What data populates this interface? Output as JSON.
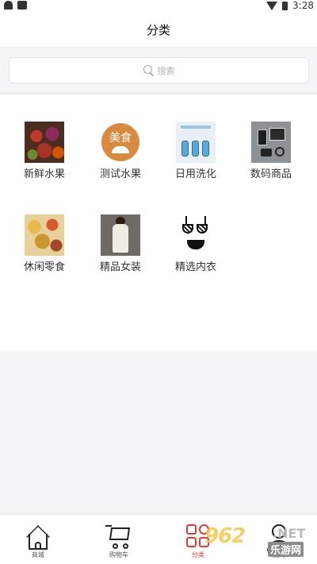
{
  "status_bar": {
    "time": "3:28"
  },
  "header": {
    "title": "分类"
  },
  "search": {
    "placeholder": "搜索"
  },
  "categories": [
    {
      "label": "新鲜水果",
      "image": "fruit-photo"
    },
    {
      "label": "测试水果",
      "image": "food-badge",
      "badge_text": "美食"
    },
    {
      "label": "日用洗化",
      "image": "toiletries-photo"
    },
    {
      "label": "数码商品",
      "image": "digital-photo"
    },
    {
      "label": "休闲零食",
      "image": "snacks-photo"
    },
    {
      "label": "精品女装",
      "image": "dress-photo"
    },
    {
      "label": "精选内衣",
      "image": "lingerie-photo"
    }
  ],
  "bottom_nav": [
    {
      "label": "商城",
      "icon": "home-icon",
      "active": false
    },
    {
      "label": "购物车",
      "icon": "cart-icon",
      "active": false
    },
    {
      "label": "分类",
      "icon": "grid-icon",
      "active": true
    },
    {
      "label": "我的",
      "icon": "user-icon",
      "active": false
    }
  ],
  "watermark": {
    "main": "962",
    "net": ".NET",
    "sub": "乐游网"
  },
  "colors": {
    "accent": "#e23b3b",
    "background": "#f5f5f7",
    "food_badge": "#d98a3f"
  }
}
